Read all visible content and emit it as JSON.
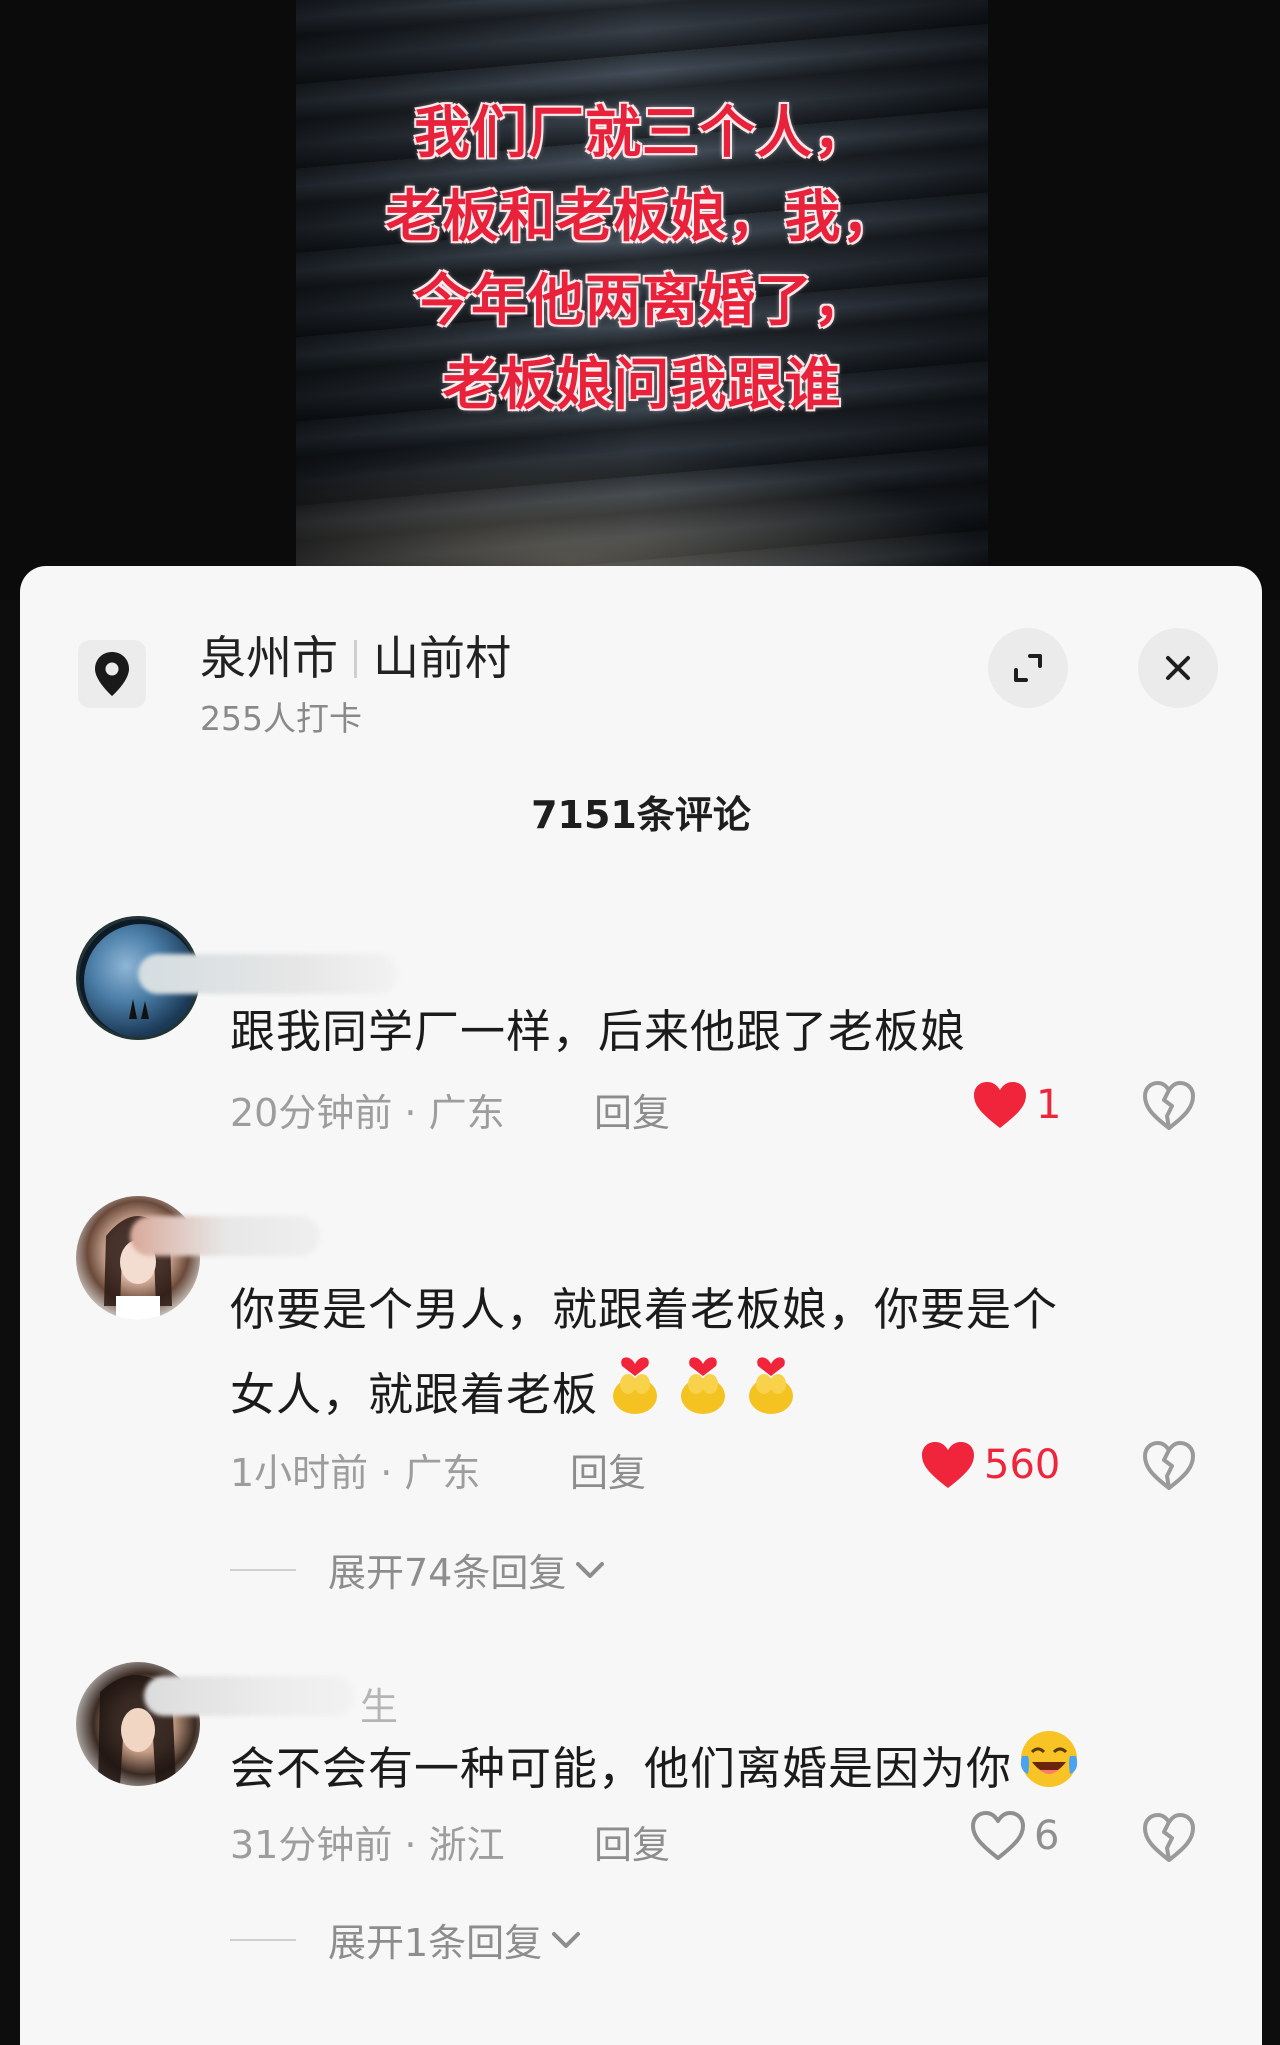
{
  "video": {
    "caption_lines": [
      "我们厂就三个人，",
      "老板和老板娘，我，",
      "今年他两离婚了，",
      "老板娘问我跟谁"
    ]
  },
  "location": {
    "city": "泉州市",
    "village": "山前村",
    "checkins": "255人打卡"
  },
  "comments_count": "7151条评论",
  "comments": [
    {
      "text": "跟我同学厂一样，后来他跟了老板娘",
      "time_region": "20分钟前 · 广东",
      "reply_label": "回复",
      "like_count": "1",
      "liked": true
    },
    {
      "text_line1": "你要是个男人，就跟着老板娘，你要是个",
      "text_line2": "女人，就跟着老板",
      "time_region": "1小时前 · 广东",
      "reply_label": "回复",
      "like_count": "560",
      "liked": true,
      "expand_label": "展开74条回复"
    },
    {
      "name_partial": "生",
      "text": "会不会有一种可能，他们离婚是因为你",
      "time_region": "31分钟前 · 浙江",
      "reply_label": "回复",
      "like_count": "6",
      "liked": false,
      "expand_label": "展开1条回复"
    }
  ],
  "colors": {
    "like_red": "#f0253c",
    "caption_red": "#e8223a",
    "sheet_bg": "#f7f7f7"
  }
}
